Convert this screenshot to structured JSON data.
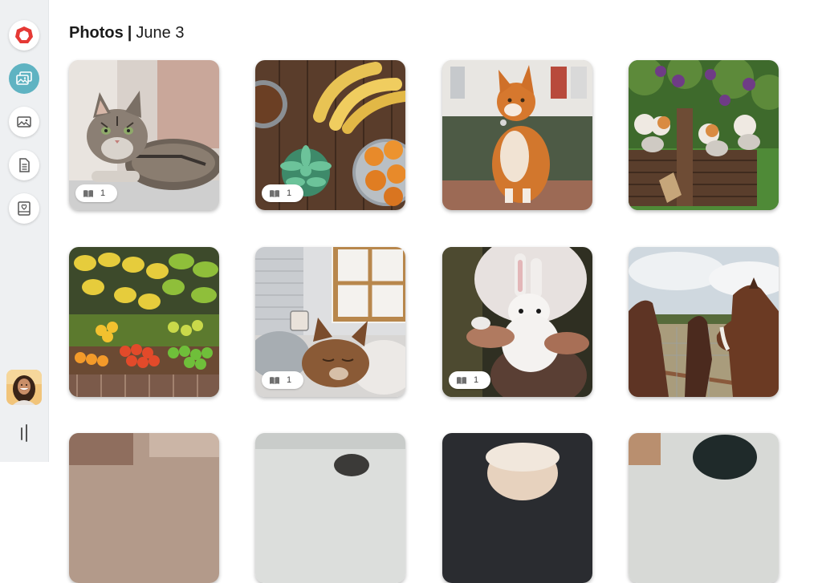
{
  "header": {
    "title": "Photos",
    "date": "June 3"
  },
  "sidebar": {
    "items": [
      {
        "name": "app-logo",
        "icon": "red-heptagon-logo"
      },
      {
        "name": "photos",
        "icon": "photos-icon",
        "active": true
      },
      {
        "name": "image",
        "icon": "image-icon"
      },
      {
        "name": "document",
        "icon": "document-icon"
      },
      {
        "name": "journal",
        "icon": "heart-book-icon"
      }
    ],
    "avatar": "user-avatar",
    "collapse": "sidebar-toggle-icon"
  },
  "photos": [
    {
      "subject": "tabby cat on couch",
      "badge": "1"
    },
    {
      "subject": "bananas oranges succulent",
      "badge": "1"
    },
    {
      "subject": "orange cat on street",
      "badge": null
    },
    {
      "subject": "kittens in basket",
      "badge": null
    },
    {
      "subject": "fruit market stall",
      "badge": null
    },
    {
      "subject": "cat sleeping on bed",
      "badge": "1"
    },
    {
      "subject": "white rabbit held in hands",
      "badge": "1"
    },
    {
      "subject": "horses at fence",
      "badge": null
    },
    {
      "subject": "partial photo",
      "badge": null
    },
    {
      "subject": "partial photo",
      "badge": null
    },
    {
      "subject": "partial photo",
      "badge": null
    },
    {
      "subject": "partial photo",
      "badge": null
    }
  ],
  "colors": {
    "accent": "#5fb3c2",
    "logo": "#e53935",
    "sidebar": "#eef0f2"
  }
}
